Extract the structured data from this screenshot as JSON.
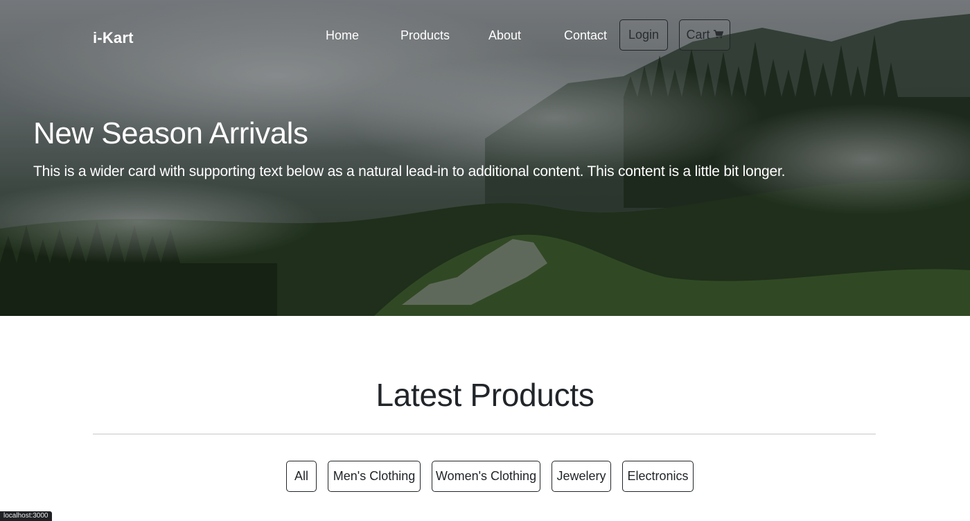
{
  "navbar": {
    "brand": "i-Kart",
    "links": [
      {
        "label": "Home"
      },
      {
        "label": "Products"
      },
      {
        "label": "About"
      },
      {
        "label": "Contact"
      }
    ],
    "login_label": "Login",
    "cart_label": "Cart",
    "cart_icon": "shopping-cart-icon"
  },
  "hero": {
    "title": "New Season Arrivals",
    "text": "This is a wider card with supporting text below as a natural lead-in to additional content. This content is a little bit longer."
  },
  "products": {
    "title": "Latest Products",
    "filters": [
      {
        "label": "All"
      },
      {
        "label": "Men's Clothing"
      },
      {
        "label": "Women's Clothing"
      },
      {
        "label": "Jewelery"
      },
      {
        "label": "Electronics"
      }
    ]
  },
  "status_bar": {
    "url": "localhost:3000"
  },
  "colors": {
    "button_border": "#212529",
    "text_dark": "#212529",
    "hero_text": "#ffffff"
  }
}
